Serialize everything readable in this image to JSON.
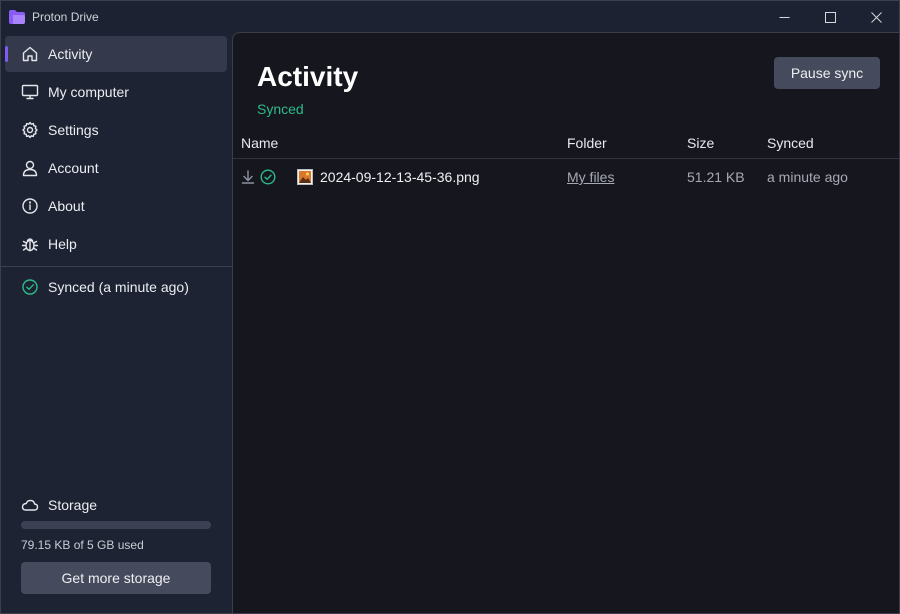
{
  "window": {
    "title": "Proton Drive"
  },
  "sidebar": {
    "items": [
      {
        "label": "Activity",
        "icon": "home-icon",
        "active": true
      },
      {
        "label": "My computer",
        "icon": "monitor-icon"
      },
      {
        "label": "Settings",
        "icon": "gear-icon"
      },
      {
        "label": "Account",
        "icon": "user-icon"
      },
      {
        "label": "About",
        "icon": "info-icon"
      },
      {
        "label": "Help",
        "icon": "bug-icon"
      }
    ],
    "sync_status": "Synced (a minute ago)",
    "storage": {
      "label": "Storage",
      "used_text": "79.15 KB of 5 GB used",
      "used_fraction": 1.55e-05,
      "button_label": "Get more storage"
    }
  },
  "main": {
    "title": "Activity",
    "status": "Synced",
    "pause_button": "Pause sync",
    "columns": {
      "name": "Name",
      "folder": "Folder",
      "size": "Size",
      "synced": "Synced"
    },
    "rows": [
      {
        "name": "2024-09-12-13-45-36.png",
        "folder": "My files",
        "size": "51.21 KB",
        "synced": "a minute ago"
      }
    ]
  },
  "colors": {
    "accent": "#7e5cf0",
    "success": "#2dbb8a",
    "sidebar_bg": "#1d2333",
    "main_bg": "#16171e"
  }
}
